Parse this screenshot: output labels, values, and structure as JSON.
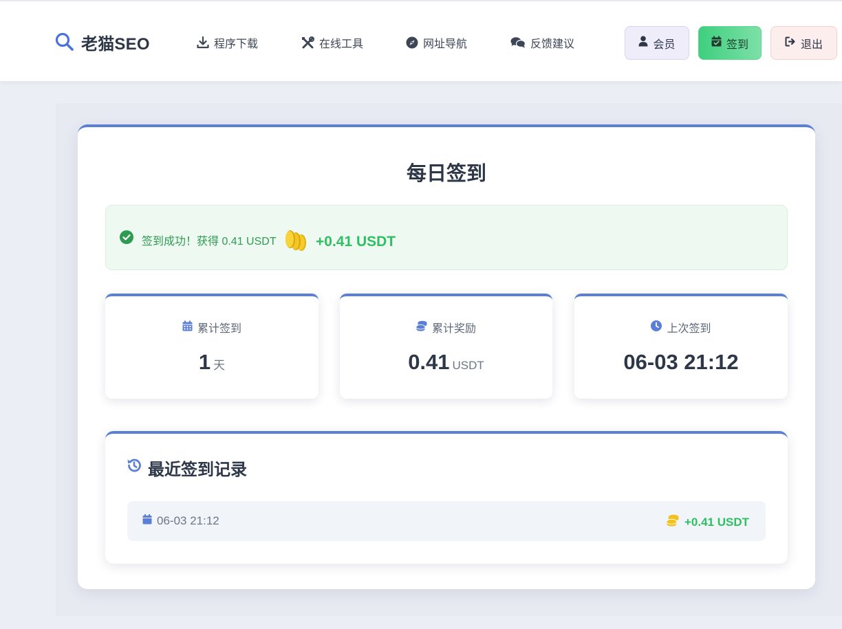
{
  "header": {
    "logo_text": "老猫SEO",
    "nav": [
      {
        "label": "程序下载",
        "icon": "download-icon"
      },
      {
        "label": "在线工具",
        "icon": "tools-icon"
      },
      {
        "label": "网址导航",
        "icon": "compass-icon"
      },
      {
        "label": "反馈建议",
        "icon": "comments-icon"
      }
    ],
    "buttons": {
      "member": "会员",
      "sign_in": "签到",
      "logout": "退出"
    }
  },
  "checkin": {
    "title": "每日签到",
    "alert_message": "签到成功！获得 0.41 USDT",
    "alert_amount": "+0.41 USDT",
    "stats": [
      {
        "label": "累计签到",
        "value": "1",
        "unit": "天",
        "icon": "calendar-icon"
      },
      {
        "label": "累计奖励",
        "value": "0.41",
        "unit": "USDT",
        "icon": "coins-icon"
      },
      {
        "label": "上次签到",
        "value": "06-03 21:12",
        "unit": "",
        "icon": "clock-icon"
      }
    ],
    "history": {
      "title": "最近签到记录",
      "records": [
        {
          "date": "06-03 21:12",
          "amount": "+0.41 USDT"
        }
      ]
    }
  },
  "colors": {
    "accent": "#5b7fd6",
    "success": "#2fbf62",
    "coin": "#f2c21b"
  }
}
